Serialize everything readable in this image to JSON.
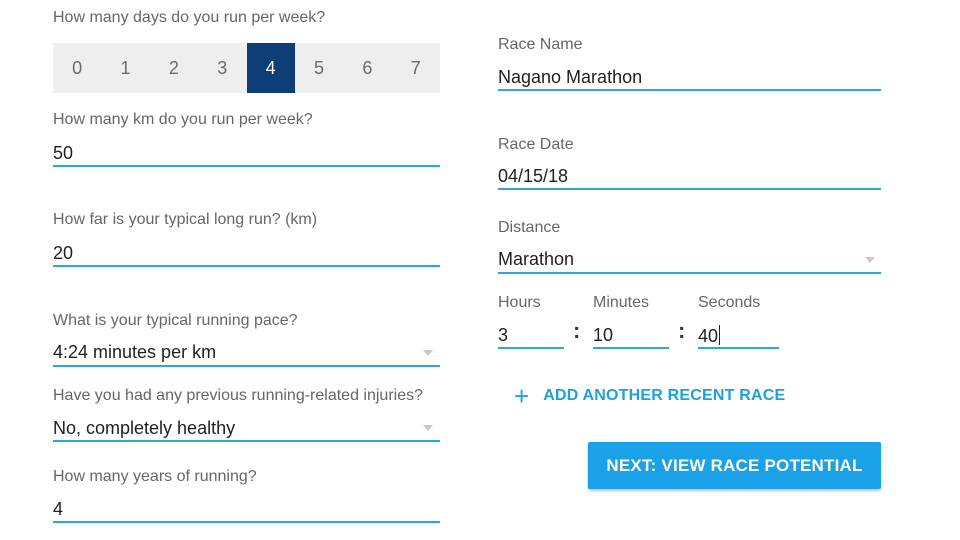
{
  "left": {
    "days_question": "How many days do you run per week?",
    "days_options": [
      "0",
      "1",
      "2",
      "3",
      "4",
      "5",
      "6",
      "7"
    ],
    "days_selected": "4",
    "km_question": "How many km do you run per week?",
    "km_value": "50",
    "long_run_question": "How far is your typical long run? (km)",
    "long_run_value": "20",
    "pace_question": "What is your typical running pace?",
    "pace_value": "4:24 minutes per km",
    "injury_question": "Have you had any previous running-related injuries?",
    "injury_value": "No, completely healthy",
    "years_question": "How many years of running?",
    "years_value": "4"
  },
  "right": {
    "race_name_label": "Race Name",
    "race_name_value": "Nagano Marathon",
    "race_date_label": "Race Date",
    "race_date_value": "04/15/18",
    "distance_label": "Distance",
    "distance_value": "Marathon",
    "time": {
      "hours_label": "Hours",
      "hours_value": "3",
      "minutes_label": "Minutes",
      "minutes_value": "10",
      "seconds_label": "Seconds",
      "seconds_value": "40",
      "separator": ":"
    },
    "add_race_label": "ADD ANOTHER RECENT RACE",
    "next_button_label": "NEXT: VIEW RACE POTENTIAL"
  },
  "colors": {
    "accent": "#29a8e0",
    "selected_day": "#0d3e78",
    "button": "#1ba1e8"
  },
  "icons": {
    "add": "plus-icon",
    "dropdown": "caret-down-icon"
  }
}
